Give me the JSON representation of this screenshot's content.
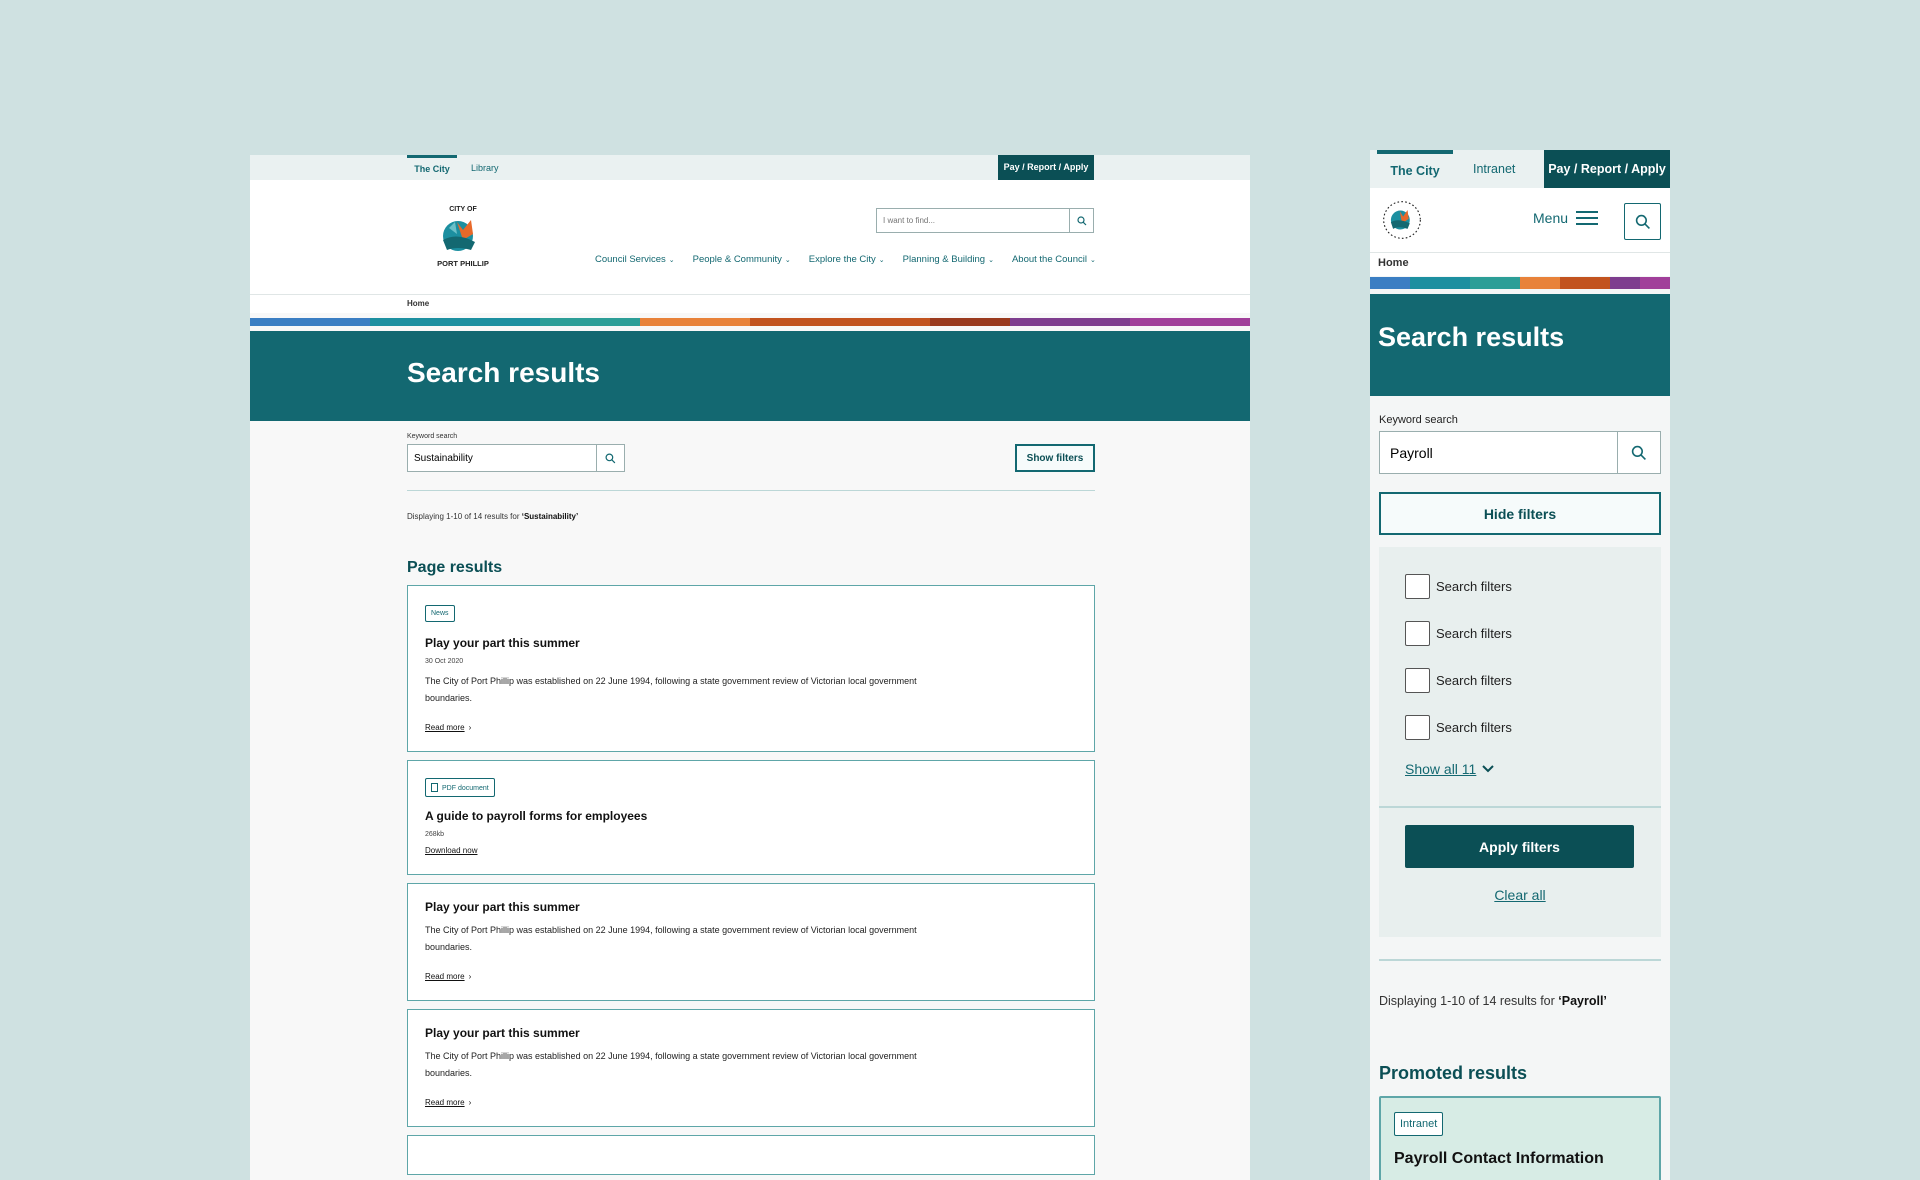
{
  "desktop": {
    "util": {
      "tab_city": "The City",
      "tab_library": "Library",
      "pay": "Pay / Report / Apply"
    },
    "search_placeholder": "I want to find...",
    "nav": [
      {
        "label": "Council Services"
      },
      {
        "label": "People & Community"
      },
      {
        "label": "Explore the City"
      },
      {
        "label": "Planning & Building"
      },
      {
        "label": "About the Council"
      }
    ],
    "breadcrumb": "Home",
    "title": "Search results",
    "keyword_label": "Keyword search",
    "keyword_value": "Sustainability",
    "show_filters": "Show filters",
    "count_prefix": "Displaying 1-10 of 14 results for ",
    "count_term": "‘Sustainability’",
    "section": "Page results",
    "results": [
      {
        "badge": "News",
        "title": "Play your part this summer",
        "date": "30 Oct 2020",
        "body": "The City of Port Phillip was established on 22 June 1994, following a state government review of Victorian local government boundaries.",
        "link": "Read more"
      },
      {
        "badge": "PDF document",
        "title": "A guide to payroll forms for employees",
        "size": "268kb",
        "link": "Download now"
      },
      {
        "title": "Play your part this summer",
        "body": "The City of Port Phillip was established on 22 June 1994, following a state government review of Victorian local government boundaries.",
        "link": "Read more"
      },
      {
        "title": "Play your part this summer",
        "body": "The City of Port Phillip was established on 22 June 1994, following a state government review of Victorian local government boundaries.",
        "link": "Read more"
      }
    ]
  },
  "mobile": {
    "util": {
      "tab_city": "The City",
      "tab_intranet": "Intranet",
      "pay": "Pay / Report / Apply"
    },
    "menu": "Menu",
    "breadcrumb": "Home",
    "title": "Search results",
    "keyword_label": "Keyword search",
    "keyword_value": "Payroll",
    "hide_filters": "Hide filters",
    "filters": [
      "Search filters",
      "Search filters",
      "Search filters",
      "Search filters"
    ],
    "show_all": "Show all 11",
    "apply": "Apply filters",
    "clear": "Clear all",
    "count_prefix": "Displaying 1-10 of 14 results for ",
    "count_term": "‘Payroll’",
    "section": "Promoted results",
    "promoted": {
      "badge": "Intranet",
      "title": "Payroll Contact Information"
    }
  },
  "colors": {
    "teal": "#136871",
    "dark_teal": "#0b4f55",
    "background": "#cfe1e1",
    "promoted_bg": "#d7ece5"
  },
  "icons": [
    "search-icon",
    "chevron-down-icon",
    "chevron-right-icon",
    "hamburger-icon",
    "pdf-icon",
    "logo"
  ]
}
